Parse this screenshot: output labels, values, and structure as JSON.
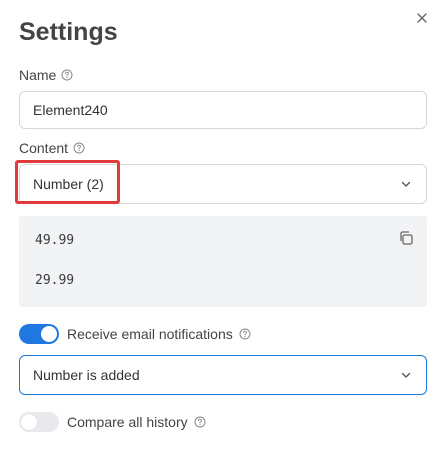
{
  "dialog": {
    "title": "Settings"
  },
  "name_field": {
    "label": "Name",
    "value": "Element240"
  },
  "content_field": {
    "label": "Content",
    "selected": "Number (2)",
    "values": [
      "49.99",
      "29.99"
    ]
  },
  "email_notifications": {
    "label": "Receive email notifications",
    "enabled": true,
    "trigger_selected": "Number is added"
  },
  "compare_history": {
    "label": "Compare all history",
    "enabled": false
  },
  "colors": {
    "accent": "#1f77e0",
    "highlight": "#e03a3a"
  },
  "icons": {
    "close": "close-icon",
    "help": "help-circle-icon",
    "chevron": "chevron-down-icon",
    "copy": "copy-icon"
  }
}
